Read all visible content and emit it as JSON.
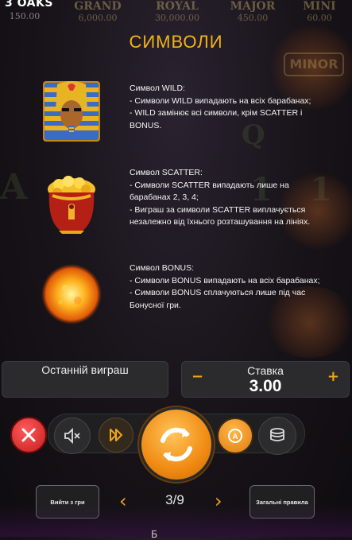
{
  "brand": "3 OAKS",
  "jackpots": [
    {
      "name": "",
      "value": "150.00"
    },
    {
      "name": "GRAND",
      "value": "6,000.00"
    },
    {
      "name": "ROYAL",
      "value": "30,000.00"
    },
    {
      "name": "MAJOR",
      "value": "450.00"
    },
    {
      "name": "MINI",
      "value": "60.00"
    }
  ],
  "background_text": {
    "minor": "MINOR",
    "q": "Q",
    "a": "A",
    "one": "1"
  },
  "title": "СИМВОЛИ",
  "symbols": [
    {
      "icon": "pharaoh-wild-icon",
      "heading": "Символ WILD:",
      "lines": "- Символи WILD випадають на всіх барабанах;\n- WILD замінює всі символи, крім SCATTER і BONUS."
    },
    {
      "icon": "golden-pot-scatter-icon",
      "heading": "Символ SCATTER:",
      "lines": "- Символи SCATTER випадають лише на барабанах 2, 3, 4;\n- Виграш за символи SCATTER виплачується незалежно від їхнього розташування на лініях."
    },
    {
      "icon": "sun-bonus-icon",
      "heading": "Символ BONUS:",
      "lines": "- Символи BONUS випадають на всіх барабанах;\n- Символи BONUS сплачуються лише під час Бонусної гри."
    }
  ],
  "last_win": {
    "label": "Останній виграш"
  },
  "stake": {
    "label": "Ставка",
    "value": "3.00",
    "minus": "−",
    "plus": "+"
  },
  "footer": {
    "exit_label": "Вийти з гри",
    "rules_label": "Загальні правила",
    "page": "3/9",
    "prev": "‹",
    "next": "›",
    "bottom_fragment": "Б"
  }
}
